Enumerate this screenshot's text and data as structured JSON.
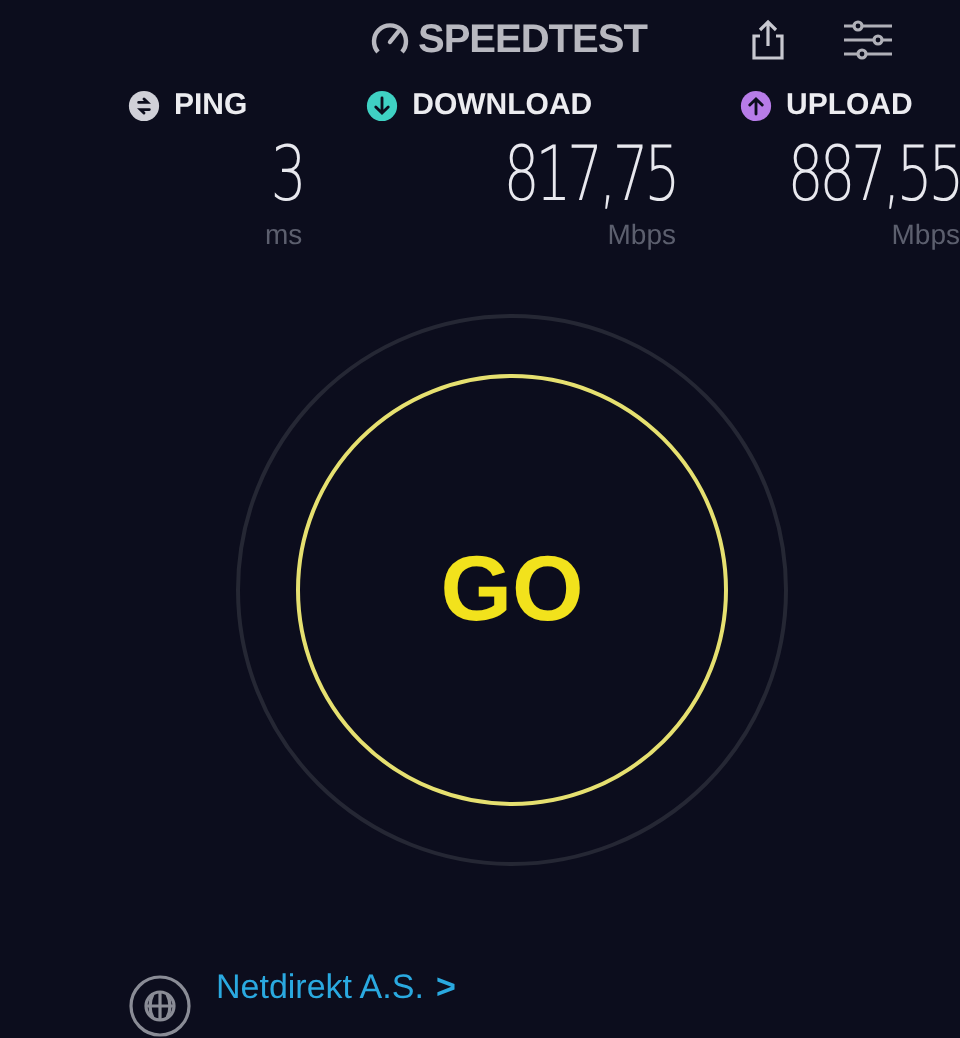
{
  "header": {
    "logo": "SPEEDTEST"
  },
  "metrics": [
    {
      "kind": "ping",
      "label": "PING",
      "value": "3",
      "unit": "ms",
      "color": "#d0d0d8"
    },
    {
      "kind": "download",
      "label": "DOWNLOAD",
      "value": "817,75",
      "unit": "Mbps",
      "color": "#3fd1c3"
    },
    {
      "kind": "upload",
      "label": "UPLOAD",
      "value": "887,55",
      "unit": "Mbps",
      "color": "#b77ce8"
    }
  ],
  "go_button": {
    "label": "GO"
  },
  "provider": {
    "name": "Netdirekt A.S.",
    "chevron": ">"
  }
}
